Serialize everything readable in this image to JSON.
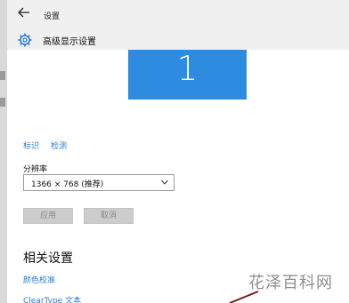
{
  "titlebar": {
    "back_icon": "back-arrow-icon",
    "title": "设置"
  },
  "header": {
    "icon": "gear-icon",
    "title": "高级显示设置"
  },
  "display": {
    "monitor_number": "1",
    "accent_color": "#2d8ce0"
  },
  "links": {
    "identify": "标识",
    "detect": "检测"
  },
  "resolution": {
    "label": "分辨率",
    "selected": "1366 × 768 (推荐)"
  },
  "buttons": {
    "apply": "应用",
    "cancel": "取消"
  },
  "related": {
    "title": "相关设置",
    "color_calibration": "颜色校准",
    "cleartype": "ClearType 文本"
  },
  "watermark": {
    "text": "花泽百科网"
  }
}
